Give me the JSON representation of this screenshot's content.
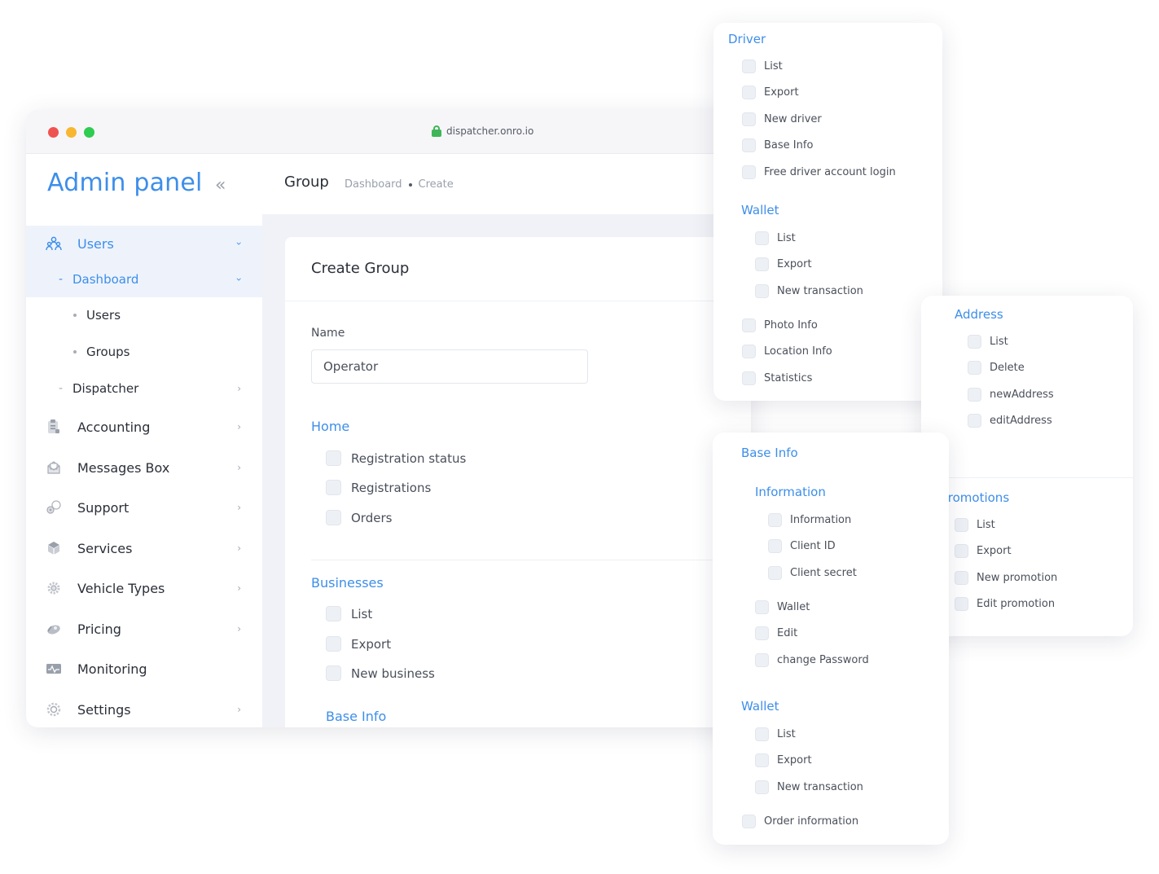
{
  "browser": {
    "url": "dispatcher.onro.io"
  },
  "sidebar": {
    "brand": "Admin panel",
    "collapse_glyph": "«",
    "items": [
      {
        "label": "Users",
        "icon": "users-icon"
      },
      {
        "label": "Accounting",
        "icon": "clipboard-icon"
      },
      {
        "label": "Messages Box",
        "icon": "mailbox-icon"
      },
      {
        "label": "Support",
        "icon": "support-icon"
      },
      {
        "label": "Services",
        "icon": "box-icon"
      },
      {
        "label": "Vehicle Types",
        "icon": "gear-cog-icon"
      },
      {
        "label": "Pricing",
        "icon": "pricing-icon"
      },
      {
        "label": "Monitoring",
        "icon": "monitor-icon"
      },
      {
        "label": "Settings",
        "icon": "settings-icon"
      }
    ],
    "users_sub": {
      "dashboard": "Dashboard",
      "dashboard_children": [
        "Users",
        "Groups"
      ],
      "dispatcher": "Dispatcher"
    }
  },
  "header": {
    "title": "Group",
    "breadcrumb": [
      "Dashboard",
      "Create"
    ]
  },
  "form": {
    "title": "Create Group",
    "name_label": "Name",
    "name_value": "Operator",
    "home": {
      "title": "Home",
      "items": [
        "Registration status",
        "Registrations",
        "Orders"
      ]
    },
    "businesses": {
      "title": "Businesses",
      "items": [
        "List",
        "Export",
        "New business"
      ]
    },
    "base_info_title": "Base Info"
  },
  "panel_driver": {
    "title": "Driver",
    "items": [
      "List",
      "Export",
      "New driver",
      "Base Info",
      "Free driver account login"
    ],
    "wallet": {
      "title": "Wallet",
      "items": [
        "List",
        "Export",
        "New transaction"
      ]
    },
    "items_after": [
      "Photo Info",
      "Location Info",
      "Statistics"
    ]
  },
  "panel_address": {
    "title": "Address",
    "items": [
      "List",
      "Delete",
      "newAddress",
      "editAddress"
    ],
    "promotions": {
      "title": "Promotions",
      "items": [
        "List",
        "Export",
        "New promotion",
        "Edit promotion"
      ]
    }
  },
  "panel_baseinfo": {
    "title": "Base Info",
    "information": {
      "title": "Information",
      "items": [
        "Information",
        "Client ID",
        "Client secret"
      ]
    },
    "items": [
      "Wallet",
      "Edit",
      "change Password"
    ],
    "wallet": {
      "title": "Wallet",
      "items": [
        "List",
        "Export",
        "New transaction"
      ]
    },
    "last": "Order information"
  },
  "colors": {
    "accent": "#3d8eea",
    "text": "#2b2f38",
    "muted": "#9aa0ab",
    "panel_bg": "#f1f2f7"
  }
}
